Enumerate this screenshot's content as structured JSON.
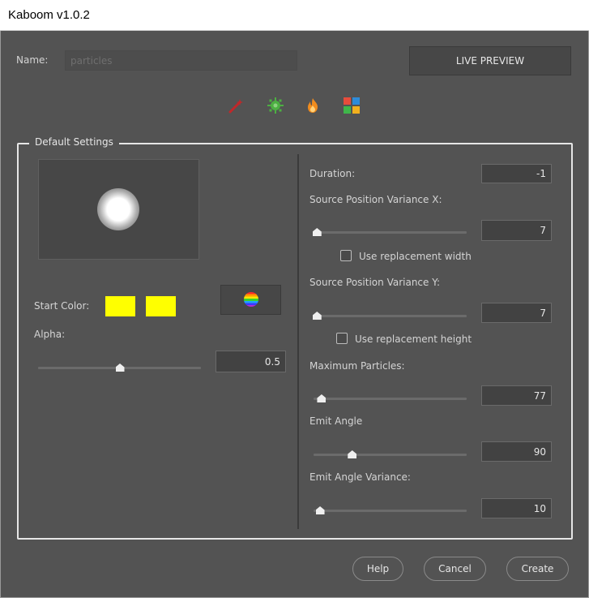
{
  "window": {
    "title": "Kaboom v1.0.2"
  },
  "header": {
    "name_label": "Name:",
    "name_placeholder": "particles",
    "live_preview_label": "LIVE PREVIEW"
  },
  "toolbar": {
    "icons": [
      {
        "name": "magic-wand-icon",
        "color": "#c0282a"
      },
      {
        "name": "sun-gear-icon",
        "color": "#4cb042"
      },
      {
        "name": "fire-icon",
        "color": "#f08c1e"
      },
      {
        "name": "color-grid-icon",
        "colors": [
          "#e74c3c",
          "#2e8bd8",
          "#3fb64a",
          "#f2b01e"
        ]
      }
    ]
  },
  "settings": {
    "legend": "Default Settings",
    "start_color_label": "Start Color:",
    "start_colors": [
      "#ffff00",
      "#ffff00"
    ],
    "alpha_label": "Alpha:",
    "alpha_value": "0.5",
    "alpha_level": 0.5,
    "duration_label": "Duration:",
    "duration_value": "-1",
    "spvx_label": "Source Position Variance X:",
    "spvx_value": "7",
    "spvx_level": 0.02,
    "use_replacement_width_label": "Use replacement width",
    "spvy_label": "Source Position Variance Y:",
    "spvy_value": "7",
    "spvy_level": 0.02,
    "use_replacement_height_label": "Use replacement height",
    "max_particles_label": "Maximum Particles:",
    "max_particles_value": "77",
    "max_particles_level": 0.05,
    "emit_angle_label": "Emit Angle",
    "emit_angle_value": "90",
    "emit_angle_level": 0.25,
    "emit_angle_variance_label": "Emit Angle Variance:",
    "emit_angle_variance_value": "10",
    "emit_angle_variance_level": 0.04
  },
  "footer": {
    "help_label": "Help",
    "cancel_label": "Cancel",
    "create_label": "Create"
  }
}
